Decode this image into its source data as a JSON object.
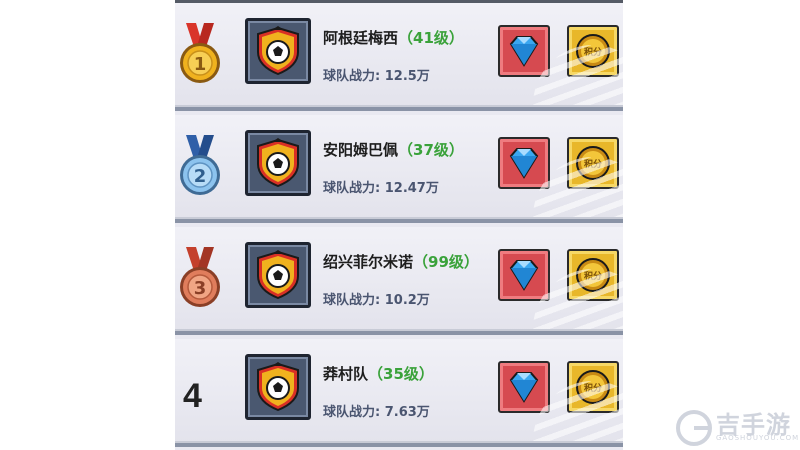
{
  "rankings": [
    {
      "rank": "1",
      "name": "阿根廷梅西",
      "level": "（41级）",
      "power_label": "球队战力:",
      "power_value": "12.5万",
      "medal": "gold-medal-icon",
      "medal_color": "#f0b21e"
    },
    {
      "rank": "2",
      "name": "安阳姆巴佩",
      "level": "（37级）",
      "power_label": "球队战力:",
      "power_value": "12.47万",
      "medal": "silver-medal-icon",
      "medal_color": "#8cc3ee"
    },
    {
      "rank": "3",
      "name": "绍兴菲尔米诺",
      "level": "（99级）",
      "power_label": "球队战力:",
      "power_value": "10.2万",
      "medal": "bronze-medal-icon",
      "medal_color": "#e07d5c"
    },
    {
      "rank": "4",
      "name": "莽村队",
      "level": "（35级）",
      "power_label": "球队战力:",
      "power_value": "7.63万",
      "medal": "",
      "medal_color": ""
    }
  ],
  "reward_icons": [
    "diamond-icon",
    "points-coin-icon"
  ],
  "coin_label": "积分",
  "watermark": {
    "text": "吉手游",
    "sub": "GAOSHOUYOU.COM"
  }
}
